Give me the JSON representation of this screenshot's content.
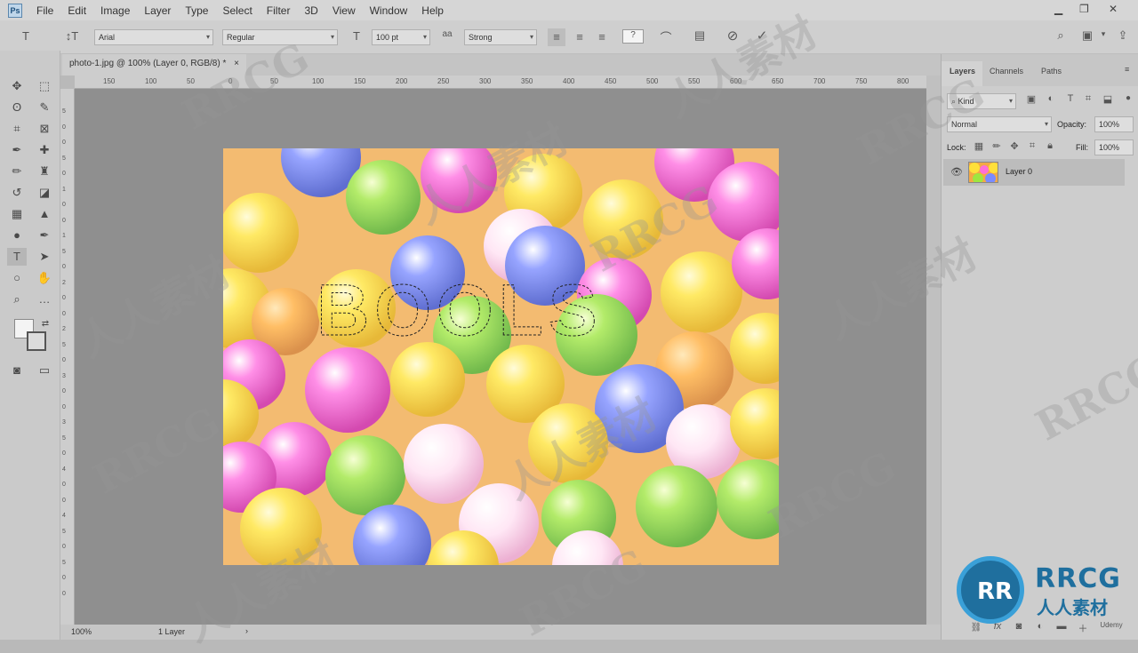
{
  "app": {
    "logo": "Ps"
  },
  "menu": [
    "File",
    "Edit",
    "Image",
    "Layer",
    "Type",
    "Select",
    "Filter",
    "3D",
    "View",
    "Window",
    "Help"
  ],
  "options": {
    "font_family": "Arial",
    "font_style": "Regular",
    "font_size": "100 pt",
    "antialias": "Strong"
  },
  "document": {
    "tab_title": "photo-1.jpg @ 100% (Layer 0, RGB/8) *",
    "close": "×",
    "selection_text": "BOOLS"
  },
  "ruler": {
    "top": [
      "150",
      "100",
      "50",
      "0",
      "50",
      "100",
      "150",
      "200",
      "250",
      "300",
      "350",
      "400",
      "450",
      "500",
      "550",
      "600",
      "650",
      "700",
      "750",
      "800"
    ],
    "left": [
      "5",
      "0",
      "0",
      "5",
      "0",
      "1",
      "0",
      "0",
      "1",
      "5",
      "0",
      "2",
      "0",
      "0",
      "2",
      "5",
      "0",
      "3",
      "0",
      "0",
      "3",
      "5",
      "0",
      "4",
      "0",
      "0",
      "4",
      "5",
      "0",
      "5",
      "0",
      "0"
    ]
  },
  "status": {
    "zoom": "100%",
    "info": "1 Layer"
  },
  "panel": {
    "tabs": [
      "Layers",
      "Channels",
      "Paths"
    ],
    "filter": "Kind",
    "blend_mode": "Normal",
    "opacity_label": "Opacity:",
    "opacity": "100%",
    "lock_label": "Lock:",
    "fill_label": "Fill:",
    "fill": "100%",
    "layer_name": "Layer 0"
  },
  "watermark": {
    "text": "RRCG",
    "cn": "人人素材"
  },
  "brand": {
    "name": "RRCG",
    "sub": "人人素材",
    "udemy": "Udemy"
  },
  "colors": {
    "accent": "#3aa0d8",
    "selection": "#000000"
  }
}
